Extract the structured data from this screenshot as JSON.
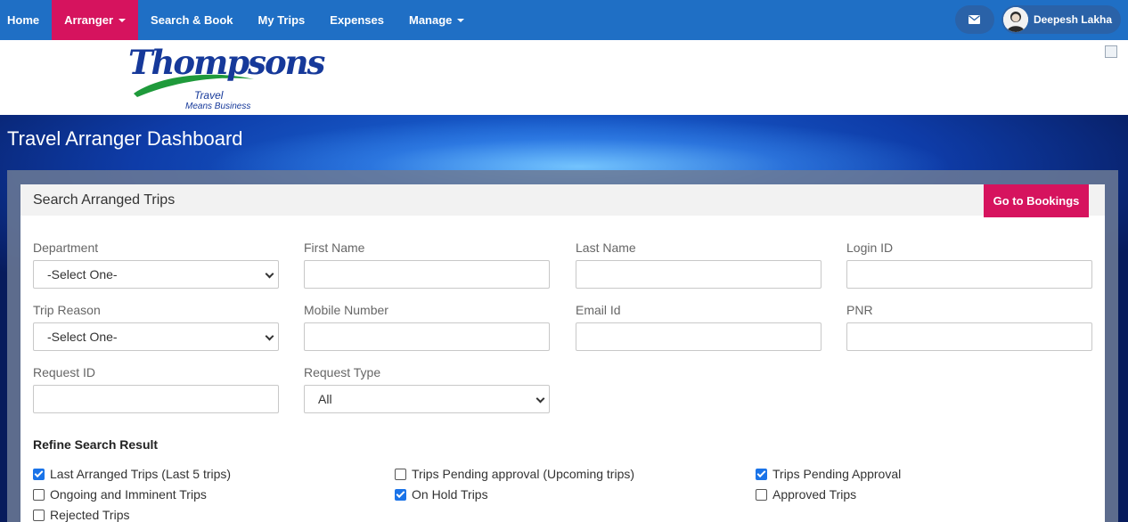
{
  "nav": {
    "items": [
      {
        "label": "Home"
      },
      {
        "label": "Arranger"
      },
      {
        "label": "Search & Book"
      },
      {
        "label": "My Trips"
      },
      {
        "label": "Expenses"
      },
      {
        "label": "Manage"
      }
    ],
    "user_name": "Deepesh Lakha",
    "accent_color": "#d6135e",
    "bar_color": "#1f6fc5"
  },
  "logo": {
    "wordmark": "Thompsons",
    "tagline_1": "Travel",
    "tagline_2": "Means Business"
  },
  "page": {
    "title": "Travel Arranger Dashboard"
  },
  "card": {
    "title": "Search Arranged Trips",
    "goto_button": "Go to Bookings"
  },
  "fields": {
    "department": {
      "label": "Department",
      "value": "-Select One-"
    },
    "first_name": {
      "label": "First Name",
      "value": ""
    },
    "last_name": {
      "label": "Last Name",
      "value": ""
    },
    "login_id": {
      "label": "Login ID",
      "value": ""
    },
    "trip_reason": {
      "label": "Trip Reason",
      "value": "-Select One-"
    },
    "mobile_number": {
      "label": "Mobile Number",
      "value": ""
    },
    "email_id": {
      "label": "Email Id",
      "value": ""
    },
    "pnr": {
      "label": "PNR",
      "value": ""
    },
    "request_id": {
      "label": "Request ID",
      "value": ""
    },
    "request_type": {
      "label": "Request Type",
      "value": "All"
    }
  },
  "refine": {
    "title": "Refine Search Result",
    "options": [
      {
        "label": "Last Arranged Trips (Last 5 trips)",
        "checked": true
      },
      {
        "label": "Trips Pending approval (Upcoming trips)",
        "checked": false
      },
      {
        "label": "Trips Pending Approval",
        "checked": true
      },
      {
        "label": "Ongoing and Imminent Trips",
        "checked": false
      },
      {
        "label": "On Hold Trips",
        "checked": true
      },
      {
        "label": "Approved Trips",
        "checked": false
      },
      {
        "label": "Rejected Trips",
        "checked": false
      }
    ]
  }
}
